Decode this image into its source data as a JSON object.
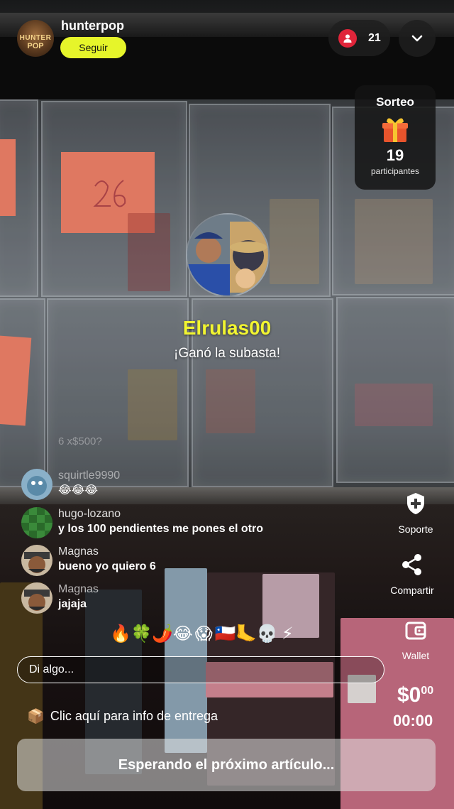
{
  "host": {
    "name": "hunterpop",
    "avatar_text_top": "HUNTER",
    "avatar_text_bottom": "POP",
    "follow_label": "Seguir"
  },
  "viewers": {
    "count": "21",
    "icon": "user-icon"
  },
  "collapse": {
    "icon": "chevron-down-icon"
  },
  "giveaway": {
    "title": "Sorteo",
    "icon": "gift-icon",
    "count": "19",
    "subtitle": "participantes"
  },
  "winner": {
    "name": "Elrulas00",
    "message": "¡Ganó la subasta!"
  },
  "chat": {
    "faded_lines": [
      "6 x$500?"
    ],
    "messages": [
      {
        "user": "squirtle9990",
        "text": "😂😂😂"
      },
      {
        "user": "hugo-lozano",
        "text": "y los 100 pendientes me pones el otro"
      },
      {
        "user": "Magnas",
        "text": "bueno yo quiero 6"
      },
      {
        "user": "Magnas",
        "text": "jajaja"
      }
    ]
  },
  "actions": {
    "support": {
      "label": "Soporte",
      "icon": "shield-plus-icon"
    },
    "share": {
      "label": "Compartir",
      "icon": "share-icon"
    },
    "wallet": {
      "label": "Wallet",
      "icon": "wallet-icon"
    }
  },
  "emojis": [
    "🔥",
    "🍀",
    "🌶️",
    "😂",
    "😱",
    "🇨🇱",
    "🦶",
    "💀",
    "⚡"
  ],
  "input": {
    "placeholder": "Di algo..."
  },
  "delivery": {
    "icon": "package-icon",
    "text": "Clic aquí para info de entrega"
  },
  "auction": {
    "price": "$0",
    "price_cents": "00",
    "timer": "00:00"
  },
  "status": {
    "label": "Esperando el próximo artículo..."
  },
  "colors": {
    "accent_yellow": "#e6f52a",
    "winner_yellow": "#f2f531",
    "viewer_red": "#e0253a"
  }
}
